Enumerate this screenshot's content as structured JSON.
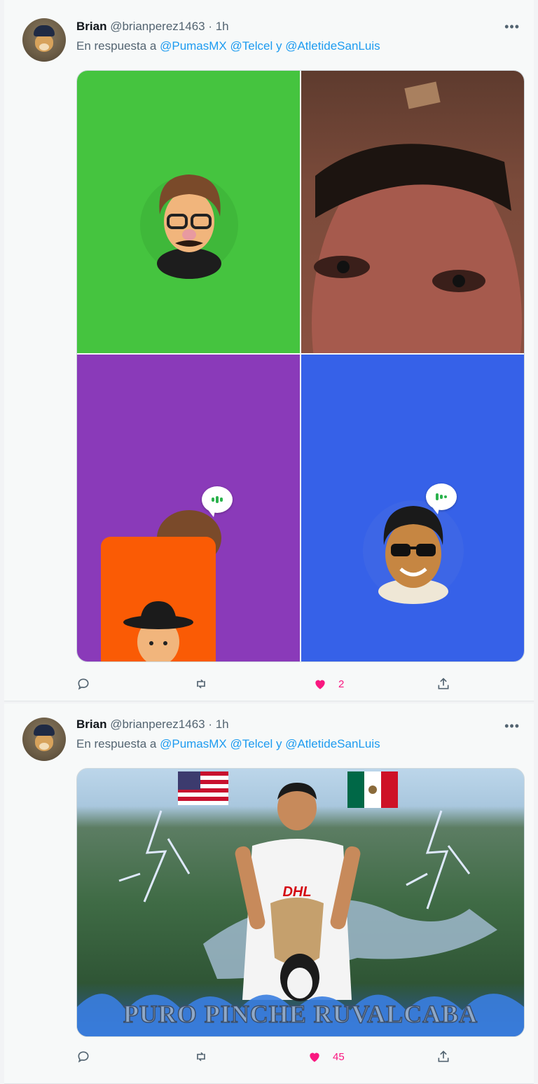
{
  "tweets": [
    {
      "name": "Brian",
      "handle": "@brianperez1463",
      "time": "· 1h",
      "more": "•••",
      "reply_prefix": "En respuesta a",
      "mention1": "@PumasMX",
      "mention2": "@Telcel",
      "conj": "y",
      "mention3": "@AtletideSanLuis",
      "likes": "2",
      "colors": {
        "tile_green": "#45c43f",
        "tile_purple": "#8a3ab9",
        "tile_blue": "#3661e8",
        "tile_orange": "#fa5b05"
      }
    },
    {
      "name": "Brian",
      "handle": "@brianperez1463",
      "time": "· 1h",
      "more": "•••",
      "reply_prefix": "En respuesta a",
      "mention1": "@PumasMX",
      "mention2": "@Telcel",
      "conj": "y",
      "mention3": "@AtletideSanLuis",
      "likes": "45",
      "image_caption": "PURO PINCHE RUVALCABA",
      "shirt_sponsor": "DHL"
    }
  ],
  "icons": [
    "reply-icon",
    "retweet-icon",
    "like-icon",
    "share-icon"
  ],
  "colors": {
    "like": "#f91880",
    "mention": "#1d9bf0",
    "muted": "#536471"
  }
}
